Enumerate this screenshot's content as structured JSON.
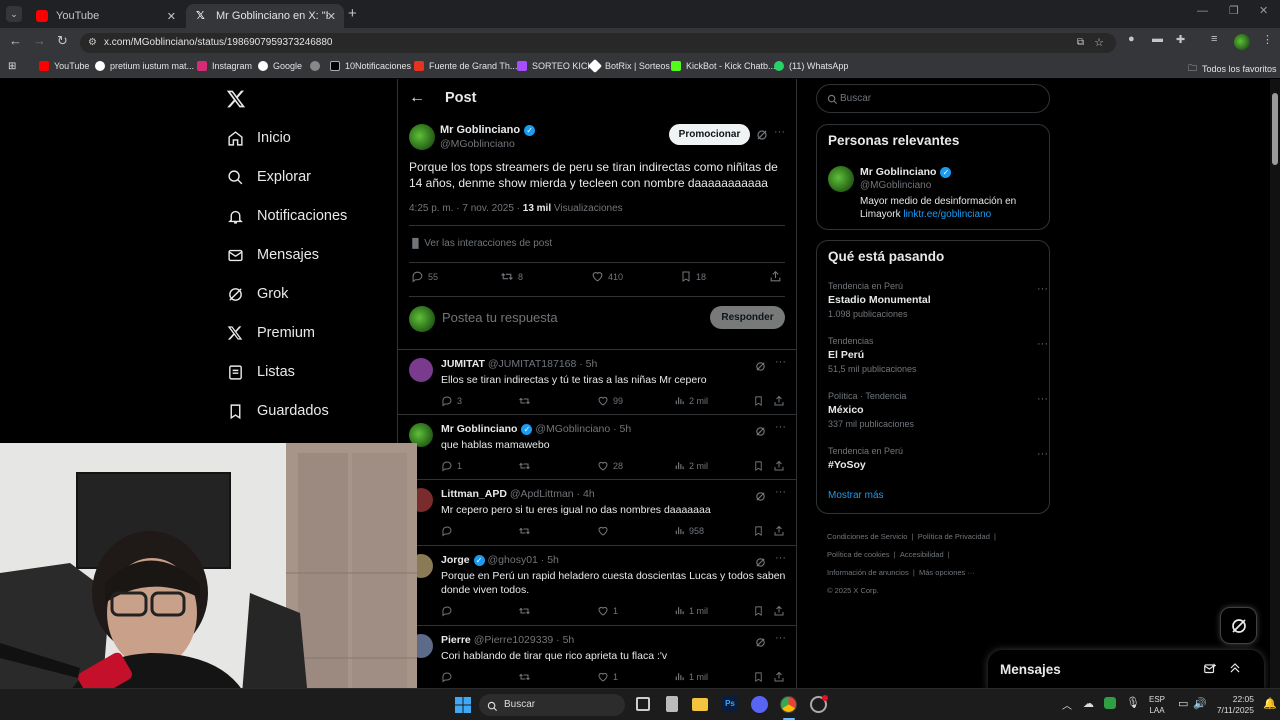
{
  "browser": {
    "tabs": [
      {
        "label": "YouTube"
      },
      {
        "label": "Mr Goblinciano en X: \"Porque l"
      }
    ],
    "url": "x.com/MGoblinciano/status/1986907959373246880",
    "bookmarks": [
      {
        "label": "YouTube",
        "color": "#ff0000"
      },
      {
        "label": "pretium iustum mat...",
        "color": "#ffffff"
      },
      {
        "label": "Instagram",
        "color": "#d62976"
      },
      {
        "label": "Google",
        "color": "#ffffff"
      },
      {
        "label": "",
        "color": "#888888"
      },
      {
        "label": "10Notificaciones",
        "color": "#000000"
      },
      {
        "label": "Fuente de Grand Th...",
        "color": "#e8321e"
      },
      {
        "label": "SORTEO KICK",
        "color": "#a64dff"
      },
      {
        "label": "BotRix | Sorteos",
        "color": "#ffffff"
      },
      {
        "label": "KickBot - Kick Chatb...",
        "color": "#53fc18"
      },
      {
        "label": "(11) WhatsApp",
        "color": "#25d366"
      }
    ],
    "all_bookmarks": "Todos los favoritos"
  },
  "nav": {
    "items": [
      {
        "label": "Inicio",
        "icon": "home-icon"
      },
      {
        "label": "Explorar",
        "icon": "search-icon"
      },
      {
        "label": "Notificaciones",
        "icon": "bell-icon"
      },
      {
        "label": "Mensajes",
        "icon": "mail-icon"
      },
      {
        "label": "Grok",
        "icon": "grok-icon"
      },
      {
        "label": "Premium",
        "icon": "x-logo-icon"
      },
      {
        "label": "Listas",
        "icon": "list-icon"
      },
      {
        "label": "Guardados",
        "icon": "bookmark-icon"
      }
    ]
  },
  "post": {
    "header": "Post",
    "author_name": "Mr Goblinciano",
    "author_handle": "@MGoblinciano",
    "promote_label": "Promocionar",
    "text": "Porque los tops streamers de peru se tiran indirectas como niñitas de 14 años, denme show mierda y tecleen con nombre daaaaaaaaaaa",
    "meta_time": "4:25 p. m. · 7 nov. 2025 · ",
    "views_count": "13 mil",
    "views_label": " Visualizaciones",
    "interactions_label": "Ver las interacciones de post",
    "stats": {
      "replies": "55",
      "reposts": "8",
      "likes": "410",
      "bookmarks": "18"
    },
    "reply_placeholder": "Postea tu respuesta",
    "reply_button": "Responder"
  },
  "replies": [
    {
      "name": "JUMITAT",
      "verified": false,
      "handle": "@JUMITAT187168",
      "time": "· 5h",
      "text": "Ellos se tiran indirectas y tú te tiras a las niñas Mr cepero",
      "replies": "3",
      "reposts": "",
      "likes": "99",
      "views": "2 mil"
    },
    {
      "name": "Mr Goblinciano",
      "verified": true,
      "handle": "@MGoblinciano",
      "time": "· 5h",
      "text": "que hablas mamawebo",
      "replies": "1",
      "reposts": "",
      "likes": "28",
      "views": "2 mil"
    },
    {
      "name": "Littman_APD",
      "verified": false,
      "handle": "@ApdLittman",
      "time": "· 4h",
      "text": "Mr cepero pero si tu eres igual no das nombres daaaaaaa",
      "replies": "",
      "reposts": "",
      "likes": "",
      "views": "958"
    },
    {
      "name": "Jorge",
      "verified": true,
      "handle": "@ghosy01",
      "time": "· 5h",
      "text": "Porque en Perú un rapid heladero cuesta doscientas Lucas y todos saben donde viven todos.",
      "replies": "",
      "reposts": "",
      "likes": "1",
      "views": "1 mil"
    },
    {
      "name": "Pierre",
      "verified": false,
      "handle": "@Pierre1029339",
      "time": "· 5h",
      "text": "Cori hablando de tirar que rico aprieta tu flaca :'v",
      "replies": "",
      "reposts": "",
      "likes": "1",
      "views": "1 mil"
    }
  ],
  "sidebar": {
    "search_placeholder": "Buscar",
    "relevant_title": "Personas relevantes",
    "relevant_name": "Mr Goblinciano",
    "relevant_handle": "@MGoblinciano",
    "relevant_bio": "Mayor medio de desinformación en Limayork ",
    "relevant_link": "linktr.ee/goblinciano",
    "trends_title": "Qué está pasando",
    "trends": [
      {
        "category": "Tendencia en Perú",
        "title": "Estadio Monumental",
        "count": "1.098 publicaciones"
      },
      {
        "category": "Tendencias",
        "title": "El Perú",
        "count": "51,5 mil publicaciones"
      },
      {
        "category": "Política · Tendencia",
        "title": "México",
        "count": "337 mil publicaciones"
      },
      {
        "category": "Tendencia en Perú",
        "title": "#YoSoy",
        "count": ""
      }
    ],
    "show_more": "Mostrar más",
    "footer": [
      "Condiciones de Servicio",
      "Política de Privacidad",
      "Política de cookies",
      "Accesibilidad",
      "Información de anuncios",
      "Más opciones ···",
      "© 2025 X Corp."
    ],
    "messages_title": "Mensajes"
  },
  "taskbar": {
    "search": "Buscar",
    "lang_top": "ESP",
    "lang_bottom": "LAA",
    "time": "22:05",
    "date": "7/11/2025"
  }
}
